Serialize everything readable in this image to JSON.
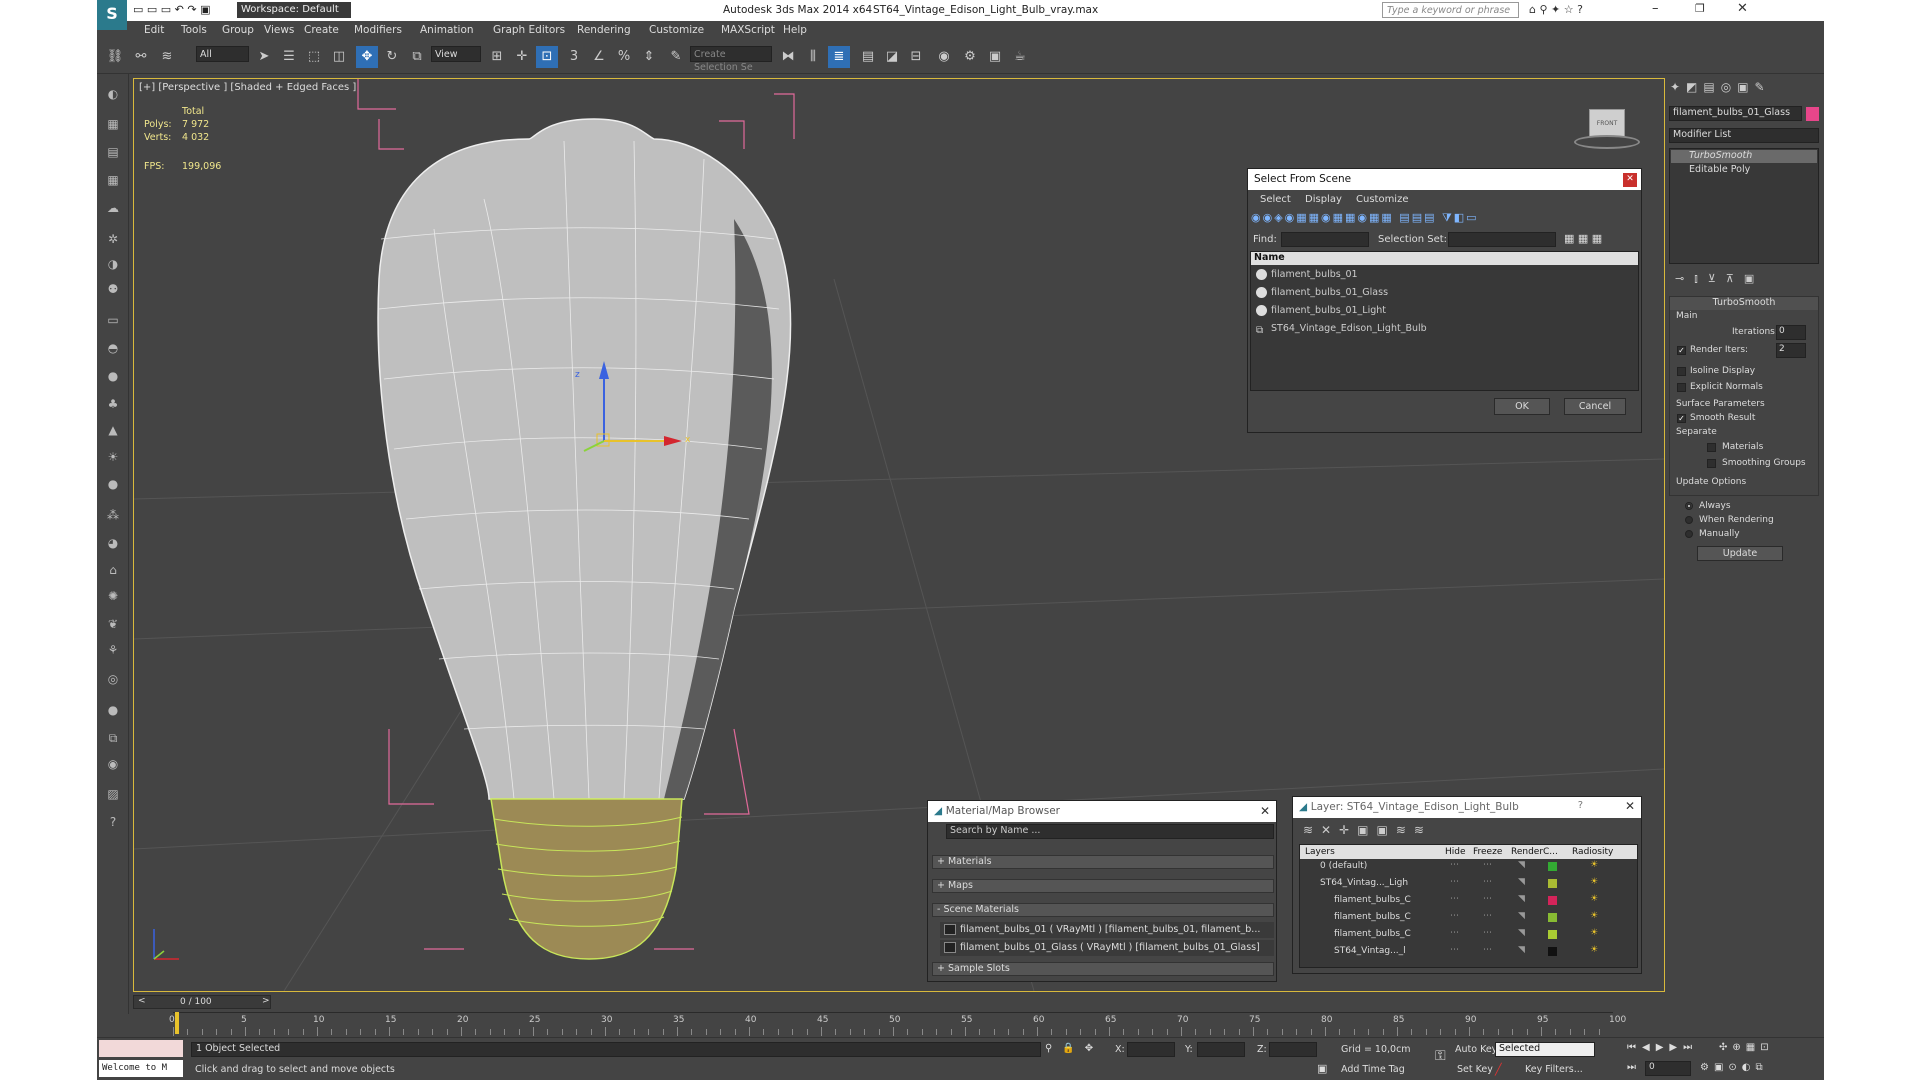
{
  "title": {
    "workspace": "Workspace: Default",
    "app": "Autodesk 3ds Max  2014 x64",
    "file": "ST64_Vintage_Edison_Light_Bulb_vray.max",
    "search_placeholder": "Type a keyword or phrase"
  },
  "menu": [
    "Edit",
    "Tools",
    "Group",
    "Views",
    "Create",
    "Modifiers",
    "Animation",
    "Graph Editors",
    "Rendering",
    "Customize",
    "MAXScript",
    "Help"
  ],
  "toolbar": {
    "filter": "All",
    "refcoord": "View",
    "selset": "Create Selection Se",
    "snap3": "3",
    "pct": "%"
  },
  "viewport": {
    "label": "[+] [Perspective ] [Shaded + Edged Faces ]",
    "stats": {
      "total": "Total",
      "polys_label": "Polys:",
      "polys": "7 972",
      "verts_label": "Verts:",
      "verts": "4 032",
      "fps_label": "FPS:",
      "fps": "199,096"
    },
    "gizmo_z": "z",
    "gizmo_x": "x",
    "cube_label": "FRONT"
  },
  "select_dialog": {
    "title": "Select From Scene",
    "menu": [
      "Select",
      "Display",
      "Customize"
    ],
    "find_label": "Find:",
    "selset_label": "Selection Set:",
    "col_name": "Name",
    "items": [
      "filament_bulbs_01",
      "filament_bulbs_01_Glass",
      "filament_bulbs_01_Light",
      "ST64_Vintage_Edison_Light_Bulb"
    ],
    "ok": "OK",
    "cancel": "Cancel"
  },
  "material_browser": {
    "title": "Material/Map Browser",
    "search": "Search by Name ...",
    "materials": "+ Materials",
    "maps": "+ Maps",
    "scene_materials": "- Scene Materials",
    "mat1": "filament_bulbs_01 ( VRayMtl ) [filament_bulbs_01, filament_b...",
    "mat2": "filament_bulbs_01_Glass ( VRayMtl ) [filament_bulbs_01_Glass]",
    "sample_slots": "+ Sample Slots"
  },
  "layer_dialog": {
    "title": "Layer: ST64_Vintage_Edison_Light_Bulb",
    "help": "?",
    "cols": [
      "Layers",
      "Hide",
      "Freeze",
      "Render",
      "C...",
      "Radiosity"
    ],
    "rows": [
      {
        "name": "0 (default)",
        "color": "#33aa33"
      },
      {
        "name": "ST64_Vintag..._Ligh",
        "color": "#aabb33"
      },
      {
        "name": "filament_bulbs_C",
        "color": "#d4245a"
      },
      {
        "name": "filament_bulbs_C",
        "color": "#88bb33"
      },
      {
        "name": "filament_bulbs_C",
        "color": "#aacc33"
      },
      {
        "name": "ST64_Vintag..._l",
        "color": "#111111"
      }
    ]
  },
  "command_panel": {
    "object_name": "filament_bulbs_01_Glass",
    "object_color": "#e8468a",
    "modifier_list": "Modifier List",
    "stack": [
      "TurboSmooth",
      "Editable Poly"
    ],
    "rollout_title": "TurboSmooth",
    "main": "Main",
    "iterations_label": "Iterations:",
    "iterations": "0",
    "render_iters_label": "Render Iters:",
    "render_iters": "2",
    "isoline": "Isoline Display",
    "explicit": "Explicit Normals",
    "surface": "Surface Parameters",
    "smooth_result": "Smooth Result",
    "separate": "Separate",
    "materials": "Materials",
    "smoothing": "Smoothing Groups",
    "update_options": "Update Options",
    "always": "Always",
    "when_rendering": "When Rendering",
    "manually": "Manually",
    "update": "Update"
  },
  "timeline": {
    "frame": "0 / 100",
    "ticks": [
      "0",
      "5",
      "10",
      "15",
      "20",
      "25",
      "30",
      "35",
      "40",
      "45",
      "50",
      "55",
      "60",
      "65",
      "70",
      "75",
      "80",
      "85",
      "90",
      "95",
      "100"
    ]
  },
  "status": {
    "welcome": "Welcome to M",
    "selected": "1 Object Selected",
    "prompt": "Click and drag to select and move objects",
    "x": "X:",
    "y": "Y:",
    "z": "Z:",
    "grid": "Grid = 10,0cm",
    "add_time_tag": "Add Time Tag",
    "auto_key": "Auto Key",
    "set_key": "Set Key",
    "selected_dd": "Selected",
    "key_filters": "Key Filters...",
    "frame_field": "0"
  }
}
